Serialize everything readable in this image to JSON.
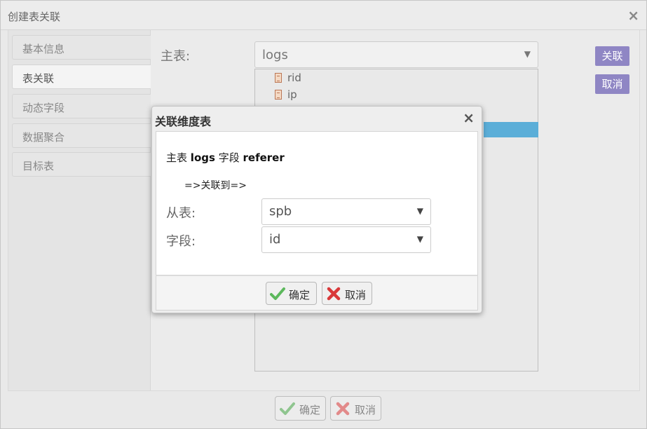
{
  "window": {
    "title": "创建表关联",
    "close_glyph": "×"
  },
  "sidebar": {
    "items": [
      {
        "label": "基本信息"
      },
      {
        "label": "表关联"
      },
      {
        "label": "动态字段"
      },
      {
        "label": "数据聚合"
      },
      {
        "label": "目标表"
      }
    ],
    "active_index": 1
  },
  "main": {
    "table_label": "主表:",
    "table_select_value": "logs",
    "fields": [
      "rid",
      "ip"
    ],
    "relate_button": "关联",
    "cancel_button": "取消"
  },
  "footer": {
    "confirm_label": "确定",
    "cancel_label": "取消"
  },
  "dialog": {
    "title": "关联维度表",
    "close_glyph": "×",
    "desc_prefix": "主表",
    "desc_table": "logs",
    "desc_mid": "字段",
    "desc_field": "referer",
    "arrow_text": "=>关联到=>",
    "from_table_label": "从表:",
    "from_table_value": "spb",
    "field_label": "字段:",
    "field_value": "id",
    "confirm_label": "确定",
    "cancel_label": "取消"
  },
  "colors": {
    "accent_purple": "#8f86c4",
    "highlight_blue": "#5baed8",
    "check_green": "#5cb85c",
    "x_red": "#d9393a"
  },
  "icons": {
    "field": "field-doc-icon",
    "caret": "caret-down-icon",
    "check": "check-icon",
    "cross": "x-icon"
  }
}
